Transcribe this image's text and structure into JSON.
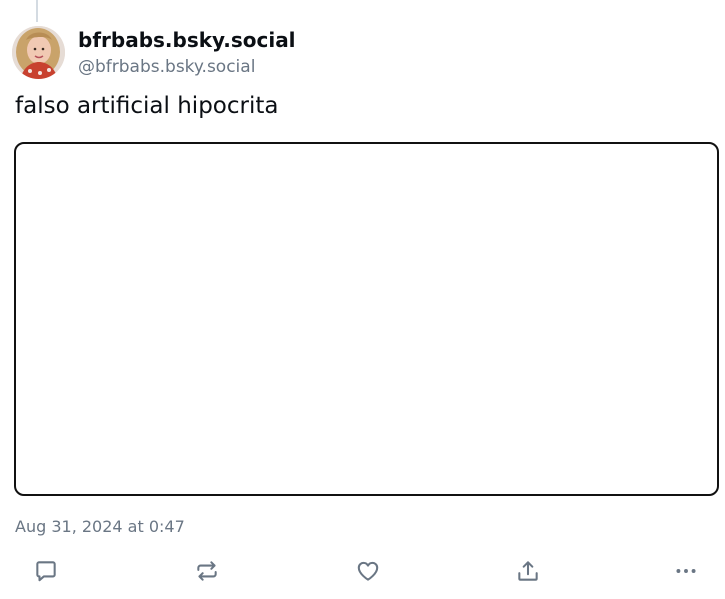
{
  "author": {
    "display_name": "bfrbabs.bsky.social",
    "handle": "@bfrbabs.bsky.social",
    "avatar_icon": "profile-photo"
  },
  "post": {
    "text": "falso artificial hipocrita",
    "timestamp": "Aug 31, 2024 at 0:47"
  },
  "actions": {
    "reply_icon": "speech-bubble-icon",
    "repost_icon": "repost-arrows-icon",
    "like_icon": "heart-icon",
    "share_icon": "share-upload-icon",
    "more_icon": "ellipsis-icon"
  },
  "colors": {
    "text_primary": "#0b0f14",
    "text_secondary": "#6a7684",
    "icon": "#6a7684",
    "thread_line": "#d4dbe2",
    "embed_border": "#111111"
  }
}
